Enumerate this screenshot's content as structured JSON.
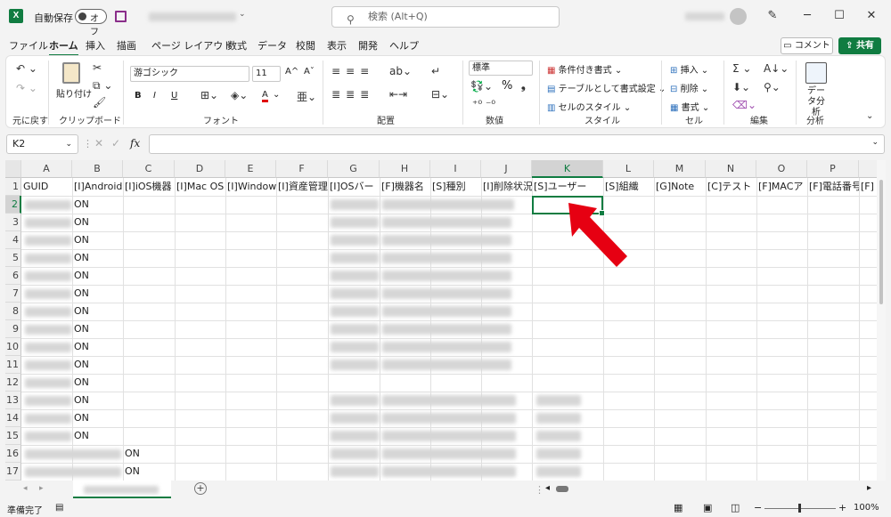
{
  "titlebar": {
    "app_icon": "X",
    "autosave_label": "自動保存",
    "autosave_state": "オフ",
    "search_placeholder": "検索 (Alt+Q)"
  },
  "menu": {
    "items": [
      "ファイル",
      "ホーム",
      "挿入",
      "描画",
      "ページ レイアウト",
      "数式",
      "データ",
      "校閲",
      "表示",
      "開発",
      "ヘルプ"
    ],
    "active": "ホーム",
    "comment_label": "コメント",
    "share_label": "共有"
  },
  "ribbon": {
    "undo_group": "元に戻す",
    "clipboard": {
      "label": "クリップボード",
      "paste": "貼り付け"
    },
    "font": {
      "label": "フォント",
      "name": "游ゴシック",
      "size": "11",
      "grow": "A^",
      "shrink": "Aˇ",
      "bold": "B",
      "italic": "I",
      "underline": "U",
      "font_color": "A"
    },
    "alignment": {
      "label": "配置"
    },
    "number": {
      "label": "数値",
      "format": "標準",
      "percent": "%"
    },
    "styles": {
      "label": "スタイル",
      "conditional": "条件付き書式",
      "table": "テーブルとして書式設定",
      "cell_style": "セルのスタイル"
    },
    "cells": {
      "label": "セル",
      "insert": "挿入",
      "delete": "削除",
      "format": "書式"
    },
    "editing": {
      "label": "編集",
      "sum": "Σ"
    },
    "analysis": {
      "label": "分析",
      "button": "データ分析"
    }
  },
  "formula_bar": {
    "name_box": "K2",
    "fx": "fx",
    "value": ""
  },
  "grid": {
    "columns": [
      "A",
      "B",
      "C",
      "D",
      "E",
      "F",
      "G",
      "H",
      "I",
      "J",
      "K",
      "L",
      "M",
      "N",
      "O",
      "P"
    ],
    "rows": [
      "1",
      "2",
      "3",
      "4",
      "5",
      "6",
      "7",
      "8",
      "9",
      "10",
      "11",
      "12",
      "13",
      "14",
      "15",
      "16",
      "17"
    ],
    "headers": [
      "GUID",
      "[I]Android",
      "[I]iOS機器",
      "[I]Mac OS",
      "[I]Window",
      "[I]資産管理",
      "[I]OSバー",
      "[F]機器名",
      "[S]種別",
      "[I]削除状況",
      "[S]ユーザー",
      "[S]組織",
      "[G]Note",
      "[C]テスト",
      "[F]MACア",
      "[F]電話番号",
      "[F]"
    ],
    "b_values": [
      "ON",
      "ON",
      "ON",
      "ON",
      "ON",
      "ON",
      "ON",
      "ON",
      "ON",
      "ON",
      "ON",
      "ON",
      "ON",
      "ON"
    ],
    "c_values": [
      "ON",
      "ON"
    ],
    "selected_cell": "K2",
    "selected_column": "K",
    "selected_row": "2"
  },
  "sheetbar": {
    "add_sheet": "+"
  },
  "statusbar": {
    "ready": "準備完了",
    "zoom": "100%"
  }
}
